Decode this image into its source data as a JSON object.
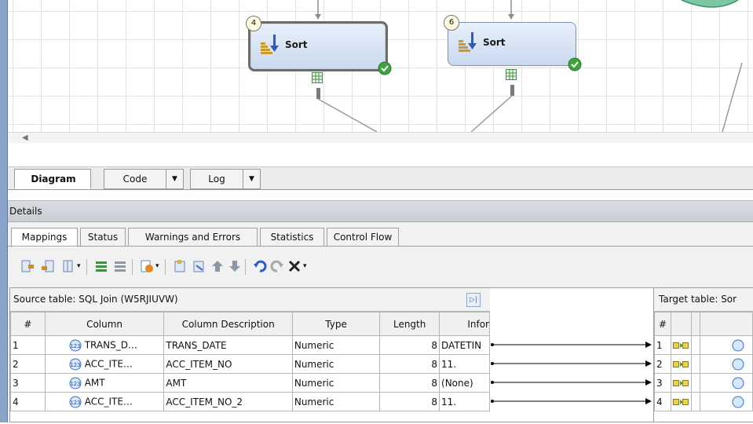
{
  "diagram": {
    "nodes": [
      {
        "number": "4",
        "label": "Sort",
        "selected": true
      },
      {
        "number": "6",
        "label": "Sort",
        "selected": false
      }
    ]
  },
  "view_tabs": [
    {
      "label": "Diagram",
      "active": true
    },
    {
      "label": "Code",
      "active": false
    },
    {
      "label": "Log",
      "active": false
    }
  ],
  "details": {
    "title": "Details",
    "tabs": [
      "Mappings",
      "Status",
      "Warnings and Errors",
      "Statistics",
      "Control Flow"
    ],
    "active_tab": "Mappings"
  },
  "toolbar_icons": [
    "import-columns-icon",
    "export-columns-icon",
    "columns-menu-icon",
    "map-all-icon",
    "unmap-all-icon",
    "expression-icon",
    "new-column-icon",
    "delete-column-icon",
    "move-up-icon",
    "move-down-icon",
    "undo-icon",
    "redo-icon",
    "delete-icon"
  ],
  "source_table": {
    "title": "Source table: SQL Join (W5RJIUVW)",
    "columns": [
      "#",
      "Column",
      "Column Description",
      "Type",
      "Length",
      "Infor"
    ],
    "rows": [
      {
        "n": "1",
        "column": "TRANS_D…",
        "description": "TRANS_DATE",
        "type": "Numeric",
        "length": "8",
        "info": "DATETIN"
      },
      {
        "n": "2",
        "column": "ACC_ITE…",
        "description": "ACC_ITEM_NO",
        "type": "Numeric",
        "length": "8",
        "info": "11."
      },
      {
        "n": "3",
        "column": "AMT",
        "description": "AMT",
        "type": "Numeric",
        "length": "8",
        "info": "(None)"
      },
      {
        "n": "4",
        "column": "ACC_ITE…",
        "description": "ACC_ITEM_NO_2",
        "type": "Numeric",
        "length": "8",
        "info": "11."
      }
    ]
  },
  "target_table": {
    "title": "Target table: Sor",
    "columns": [
      "#"
    ],
    "rows": [
      "1",
      "2",
      "3",
      "4"
    ]
  },
  "colors": {
    "accent": "#5f7ba3",
    "node_fill": "#c9d9ee",
    "status_ok": "#3fa23f"
  }
}
